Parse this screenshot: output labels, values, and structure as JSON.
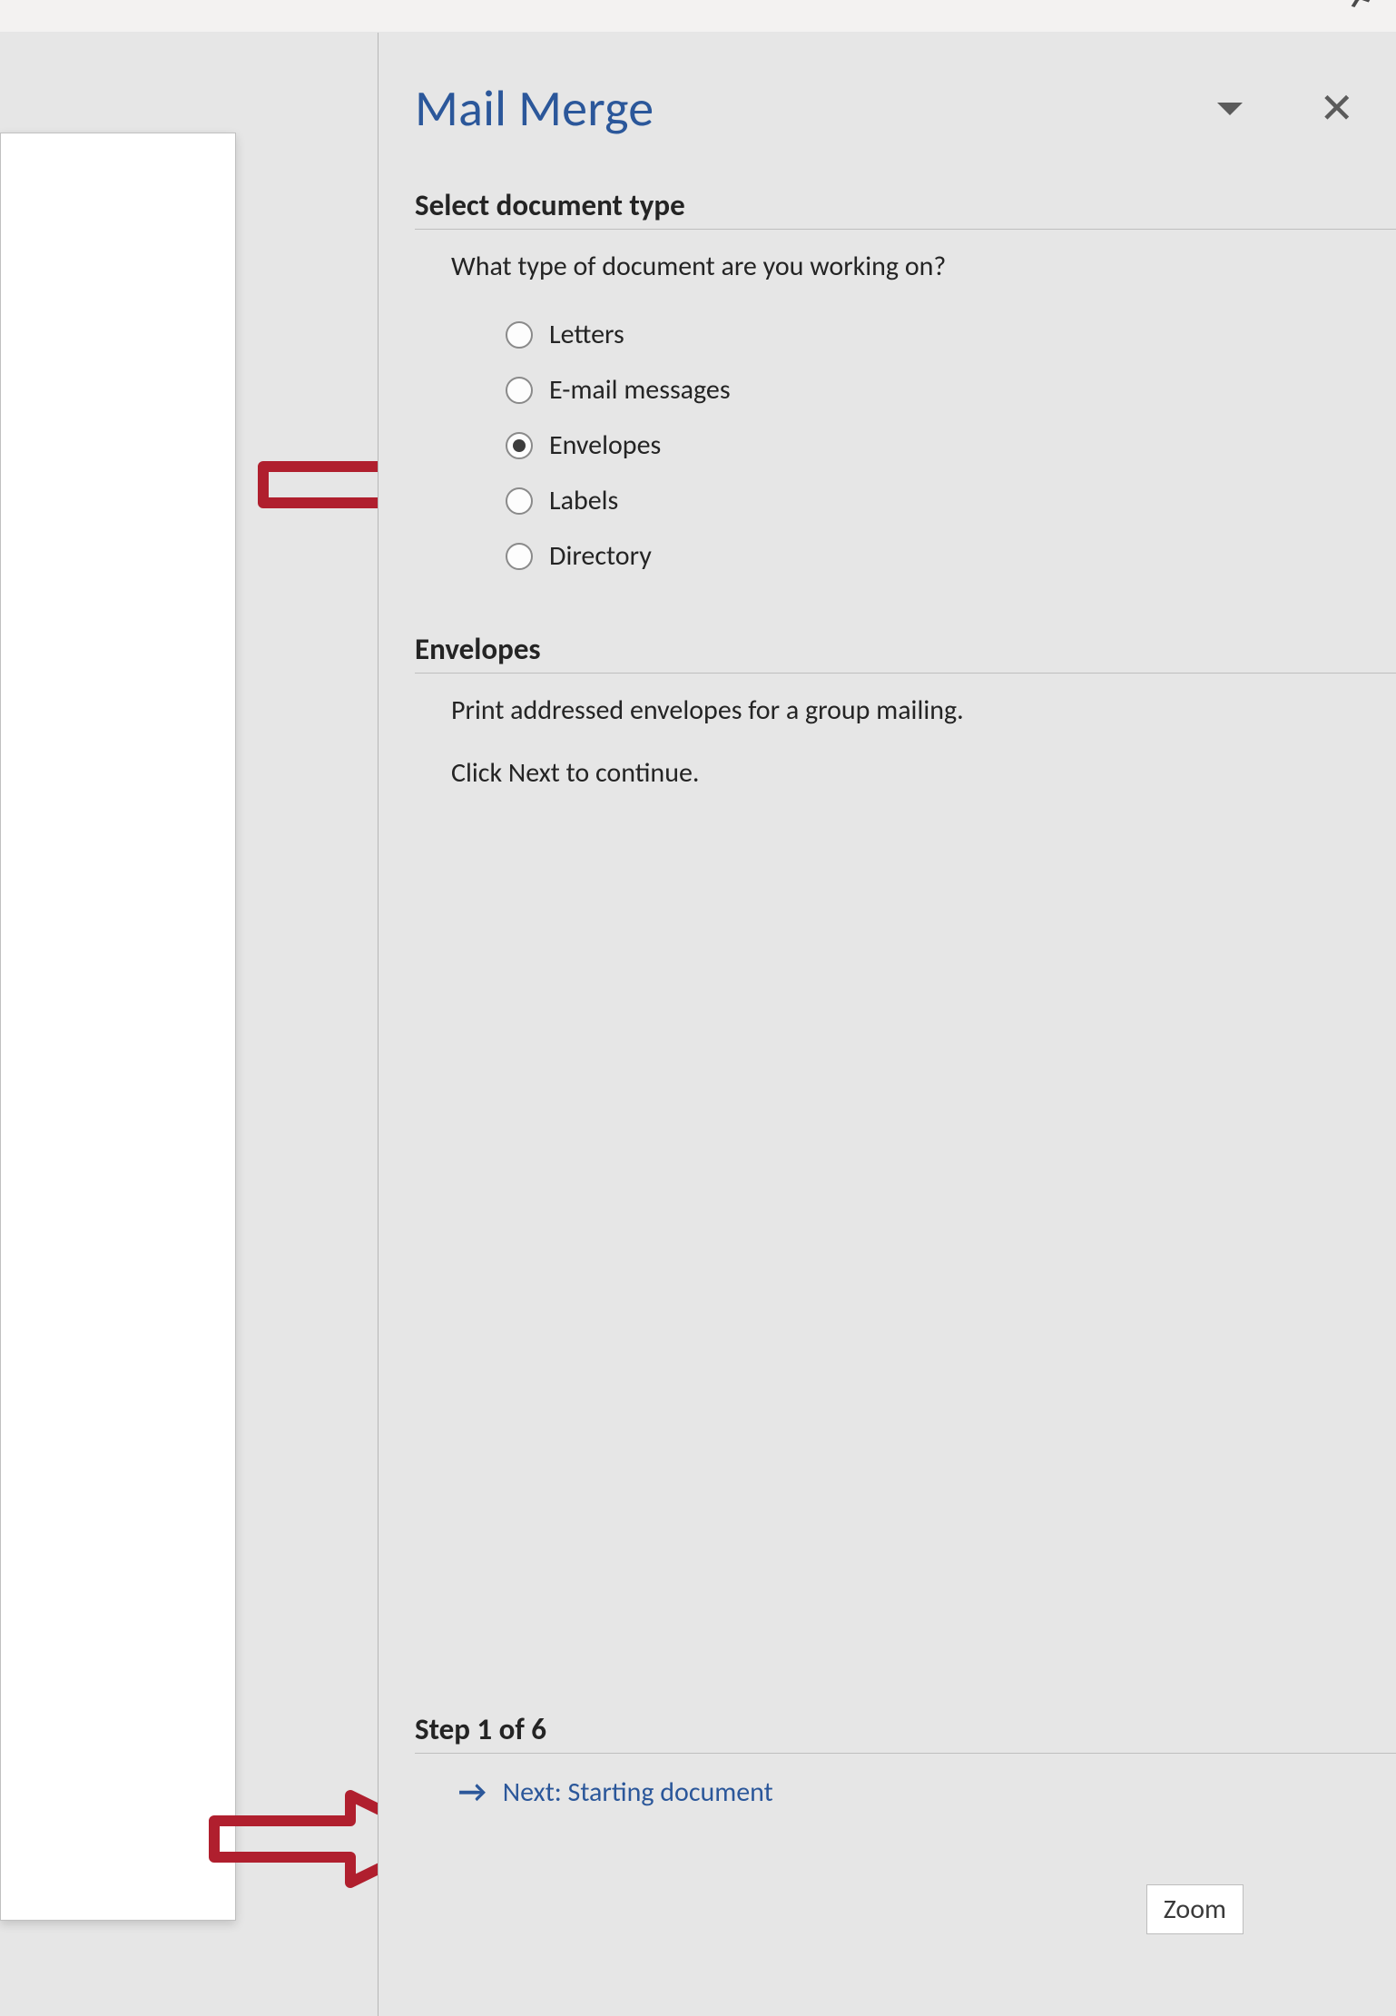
{
  "pane": {
    "title": "Mail Merge"
  },
  "select_type": {
    "header": "Select document type",
    "prompt": "What type of document are you working on?",
    "options": [
      {
        "label": "Letters",
        "selected": false
      },
      {
        "label": "E-mail messages",
        "selected": false
      },
      {
        "label": "Envelopes",
        "selected": true
      },
      {
        "label": "Labels",
        "selected": false
      },
      {
        "label": "Directory",
        "selected": false
      }
    ]
  },
  "envelope_section": {
    "header": "Envelopes",
    "line1": "Print addressed envelopes for a group mailing.",
    "line2": "Click Next to continue."
  },
  "step": {
    "header": "Step 1 of 6",
    "next_label": "Next: Starting document"
  },
  "zoom": {
    "label": "Zoom"
  }
}
